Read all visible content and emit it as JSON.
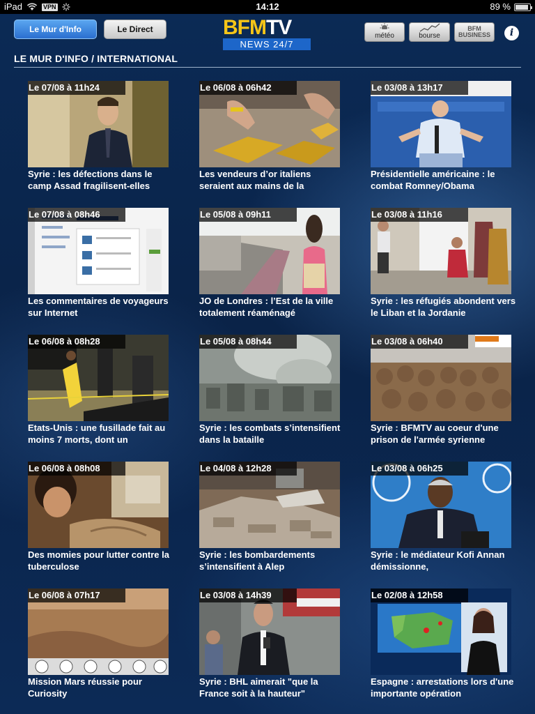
{
  "status_bar": {
    "device": "iPad",
    "vpn": "VPN",
    "time": "14:12",
    "battery": "89 %",
    "battery_level": 0.89
  },
  "header": {
    "tab_mur": "Le Mur d'Info",
    "tab_direct": "Le Direct",
    "logo_top_1": "BFM",
    "logo_top_2": "TV",
    "logo_bottom": "NEWS 24/7",
    "meteo": "météo",
    "bourse": "bourse",
    "bfm_business_1": "BFM",
    "bfm_business_2": "BUSINESS",
    "info": "i"
  },
  "section_title": "LE MUR D'INFO / INTERNATIONAL",
  "colors": {
    "background": "#0b2347",
    "accent": "#2b6fd0",
    "logo_yellow": "#f5c518"
  },
  "articles": [
    {
      "date": "Le 07/08 à 11h24",
      "title": "Syrie : les défections dans le camp Assad fragilisent-elles"
    },
    {
      "date": "Le 06/08 à 06h42",
      "title": "Les vendeurs d’or italiens seraient aux mains de la"
    },
    {
      "date": "Le 03/08 à 13h17",
      "title": "Présidentielle américaine : le combat Romney/Obama"
    },
    {
      "date": "Le 07/08 à 08h46",
      "title": "Les commentaires de voyageurs sur Internet"
    },
    {
      "date": "Le 05/08 à 09h11",
      "title": "JO de Londres : l’Est de la ville totalement réaménagé"
    },
    {
      "date": "Le 03/08 à 11h16",
      "title": "Syrie : les réfugiés abondent vers le Liban et la Jordanie"
    },
    {
      "date": "Le 06/08 à 08h28",
      "title": "Etats-Unis : une fusillade fait au moins 7 morts, dont un"
    },
    {
      "date": "Le 05/08 à 08h44",
      "title": "Syrie : les combats s’intensifient dans la bataille"
    },
    {
      "date": "Le 03/08 à 06h40",
      "title": "Syrie : BFMTV au coeur d'une prison de l'armée syrienne"
    },
    {
      "date": "Le 06/08 à 08h08",
      "title": "Des momies pour lutter contre la tuberculose"
    },
    {
      "date": "Le 04/08 à 12h28",
      "title": "Syrie : les bombardements s’intensifient à Alep"
    },
    {
      "date": "Le 03/08 à 06h25",
      "title": "Syrie : le médiateur Kofi Annan démissionne,"
    },
    {
      "date": "Le 06/08 à 07h17",
      "title": "Mission Mars réussie pour Curiosity"
    },
    {
      "date": "Le 03/08 à 14h39",
      "title": "Syrie : BHL aimerait \"que la France soit à la hauteur\""
    },
    {
      "date": "Le 02/08 à 12h58",
      "title": "Espagne : arrestations lors d'une importante opération"
    }
  ]
}
